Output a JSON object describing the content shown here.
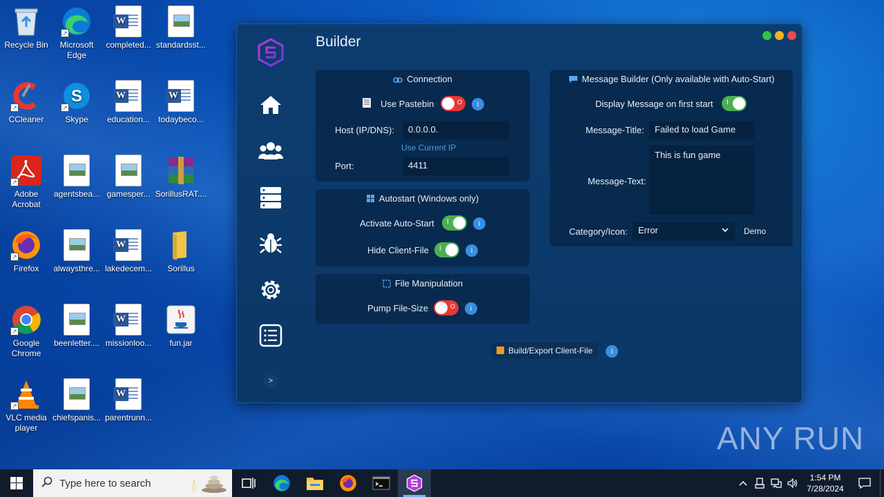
{
  "desktop": {
    "icons": [
      {
        "label": "Recycle Bin"
      },
      {
        "label": "Microsoft Edge"
      },
      {
        "label": "completed..."
      },
      {
        "label": "standardsst..."
      },
      {
        "label": "CCleaner"
      },
      {
        "label": "Skype"
      },
      {
        "label": "education..."
      },
      {
        "label": "todaybeco..."
      },
      {
        "label": "Adobe Acrobat"
      },
      {
        "label": "agentsbea..."
      },
      {
        "label": "gamesper..."
      },
      {
        "label": "SorillusRAT...."
      },
      {
        "label": "Firefox"
      },
      {
        "label": "alwaysthre..."
      },
      {
        "label": "lakedecem..."
      },
      {
        "label": "Sorillus"
      },
      {
        "label": "Google Chrome"
      },
      {
        "label": "beenletter...."
      },
      {
        "label": "missionloo..."
      },
      {
        "label": "fun.jar"
      },
      {
        "label": "VLC media player"
      },
      {
        "label": "chiefspanis..."
      },
      {
        "label": "parentrunn..."
      }
    ]
  },
  "app": {
    "title": "Builder",
    "connection": {
      "title": "Connection",
      "use_pastebin_label": "Use Pastebin",
      "use_pastebin_on": false,
      "host_label": "Host (IP/DNS):",
      "host_value": "0.0.0.0.",
      "use_current_ip": "Use Current IP",
      "port_label": "Port:",
      "port_value": "4411"
    },
    "autostart": {
      "title": "Autostart (Windows only)",
      "activate_label": "Activate Auto-Start",
      "activate_on": true,
      "hide_label": "Hide Client-File",
      "hide_on": true
    },
    "file_manipulation": {
      "title": "File Manipulation",
      "pump_label": "Pump File-Size",
      "pump_on": false
    },
    "message_builder": {
      "title": "Message Builder (Only available with Auto-Start)",
      "display_label": "Display Message on first start",
      "display_on": true,
      "msg_title_label": "Message-Title:",
      "msg_title_value": "Failed to load Game",
      "msg_text_label": "Message-Text:",
      "msg_text_value": "This is fun game",
      "category_label": "Category/Icon:",
      "category_value": "Error",
      "demo_label": "Demo"
    },
    "build_label": "Build/Export Client-File",
    "collapse_label": ">",
    "info_glyph": "i",
    "toggle_on_mark": "I",
    "toggle_off_mark": "O"
  },
  "taskbar": {
    "search_placeholder": "Type here to search",
    "time": "1:54 PM",
    "date": "7/28/2024"
  },
  "watermark": "ANY RUN",
  "colors": {
    "toggle_on": "#4caf50",
    "toggle_off": "#e53935",
    "info": "#3a8de0",
    "link": "#4f9ce8",
    "window_close": "#e84c4c",
    "window_min": "#f2b521",
    "window_max": "#35c04a"
  }
}
